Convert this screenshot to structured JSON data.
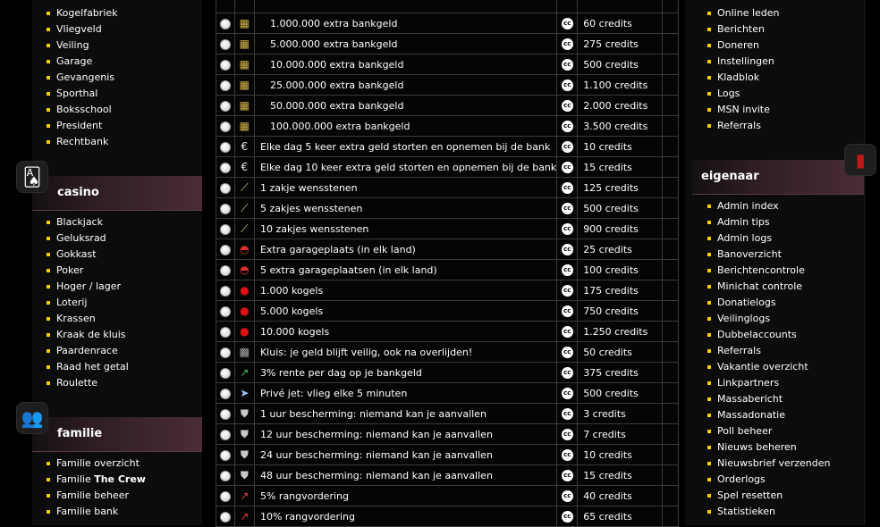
{
  "left_nav": {
    "top_items": [
      "Kogelfabriek",
      "Vliegveld",
      "Veiling",
      "Garage",
      "Gevangenis",
      "Sporthal",
      "Boksschool",
      "President",
      "Rechtbank"
    ],
    "casino": {
      "title": "casino",
      "items": [
        "Blackjack",
        "Geluksrad",
        "Gokkast",
        "Poker",
        "Hoger / lager",
        "Loterij",
        "Krassen",
        "Kraak de kluis",
        "Paardenrace",
        "Raad het getal",
        "Roulette"
      ]
    },
    "familie": {
      "title": "familie",
      "items": [
        "Familie overzicht",
        "Familie ",
        "Familie beheer",
        "Familie bank"
      ],
      "crew_name": "The Crew"
    }
  },
  "right_nav": {
    "top_items": [
      "Online leden",
      "Berichten",
      "Doneren",
      "Instellingen",
      "Kladblok",
      "Logs",
      "MSN invite",
      "Referrals"
    ],
    "eigenaar": {
      "title": "eigenaar",
      "items": [
        "Admin index",
        "Admin tips",
        "Admin logs",
        "Banoverzicht",
        "Berichtencontrole",
        "Minichat controle",
        "Donatielogs",
        "Veilinglogs",
        "Dubbelaccounts",
        "Referrals",
        "Vakantie overzicht",
        "Linkpartners",
        "Massabericht",
        "Massadonatie",
        "Poll beheer",
        "Nieuws beheren",
        "Nieuwsbrief verzenden",
        "Orderlogs",
        "Spel resetten",
        "Statistieken"
      ]
    }
  },
  "currency_label": "cc",
  "shop": [
    {
      "icon": "money-icon",
      "name": "1.000.000 extra bankgeld",
      "price": "60 credits",
      "indent": true
    },
    {
      "icon": "money-icon",
      "name": "5.000.000 extra bankgeld",
      "price": "275 credits",
      "indent": true
    },
    {
      "icon": "money-icon",
      "name": "10.000.000 extra bankgeld",
      "price": "500 credits",
      "indent": true
    },
    {
      "icon": "money-icon",
      "name": "25.000.000 extra bankgeld",
      "price": "1.100 credits",
      "indent": true
    },
    {
      "icon": "money-icon",
      "name": "50.000.000 extra bankgeld",
      "price": "2.000 credits",
      "indent": true
    },
    {
      "icon": "money-icon",
      "name": "100.000.000 extra bankgeld",
      "price": "3.500 credits",
      "indent": true
    },
    {
      "icon": "euro-icon",
      "name": "Elke dag 5 keer extra geld storten en opnemen bij de bank",
      "price": "10 credits"
    },
    {
      "icon": "euro-icon",
      "name": "Elke dag 10 keer extra geld storten en opnemen bij de bank",
      "price": "15 credits"
    },
    {
      "icon": "wand-icon",
      "name": "1 zakje wensstenen",
      "price": "125 credits"
    },
    {
      "icon": "wand-icon",
      "name": "5 zakjes wensstenen",
      "price": "500 credits"
    },
    {
      "icon": "wand-icon",
      "name": "10 zakjes wensstenen",
      "price": "900 credits"
    },
    {
      "icon": "car-icon",
      "name": "Extra garageplaats (in elk land)",
      "price": "25 credits"
    },
    {
      "icon": "car-icon",
      "name": "5 extra garageplaatsen (in elk land)",
      "price": "100 credits"
    },
    {
      "icon": "bullet-icon",
      "name": "1.000 kogels",
      "price": "175 credits"
    },
    {
      "icon": "bullet-icon",
      "name": "5.000 kogels",
      "price": "750 credits"
    },
    {
      "icon": "bullet-icon",
      "name": "10.000 kogels",
      "price": "1.250 credits"
    },
    {
      "icon": "safe-icon",
      "name": "Kluis: je geld blijft veilig, ook na overlijden!",
      "price": "50 credits"
    },
    {
      "icon": "chart-up-icon",
      "name": "3% rente per dag op je bankgeld",
      "price": "375 credits"
    },
    {
      "icon": "plane-icon",
      "name": "Privé jet: vlieg elke 5 minuten",
      "price": "500 credits"
    },
    {
      "icon": "shield-icon",
      "name": "1 uur bescherming: niemand kan je aanvallen",
      "price": "3 credits"
    },
    {
      "icon": "shield-icon",
      "name": "12 uur bescherming: niemand kan je aanvallen",
      "price": "7 credits"
    },
    {
      "icon": "shield-icon",
      "name": "24 uur bescherming: niemand kan je aanvallen",
      "price": "10 credits"
    },
    {
      "icon": "shield-icon",
      "name": "48 uur bescherming: niemand kan je aanvallen",
      "price": "15 credits"
    },
    {
      "icon": "rank-icon",
      "name": "5% rangvordering",
      "price": "40 credits"
    },
    {
      "icon": "rank-icon",
      "name": "10% rangvordering",
      "price": "65 credits"
    }
  ]
}
